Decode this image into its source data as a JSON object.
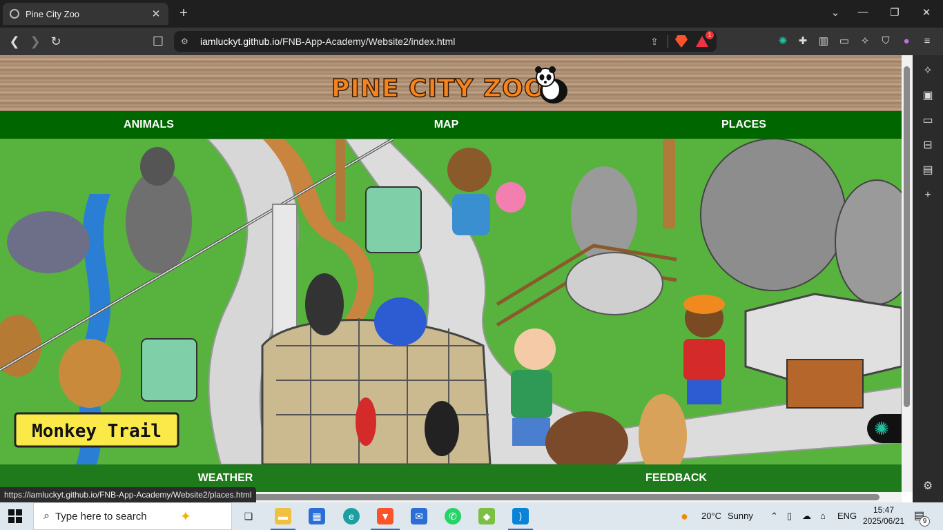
{
  "browser": {
    "tab_title": "Pine City Zoo",
    "tab_close": "✕",
    "new_tab": "+",
    "url_host": "iamluckyt.github.io",
    "url_path": "/FNB-App-Academy/Website2/index.html",
    "rewards_badge": "1",
    "status_url": "https://iamluckyt.github.io/FNB-App-Academy/Website2/places.html"
  },
  "site": {
    "logo_text": "PINE CITY ZOO",
    "nav": {
      "animals": "ANIMALS",
      "map": "MAP",
      "places": "PLACES"
    },
    "footer_nav": {
      "weather": "WEATHER",
      "feedback": "FEEDBACK"
    },
    "scene_sign": "Monkey Trail"
  },
  "taskbar": {
    "search_placeholder": "Type here to search",
    "weather_temp": "20°C",
    "weather_text": "Sunny",
    "language": "ENG",
    "time": "15:47",
    "date": "2025/06/21",
    "notification_count": "9"
  },
  "colors": {
    "nav_green": "#006600",
    "footer_green": "#1e7a1a",
    "logo_orange": "#f5841f"
  }
}
